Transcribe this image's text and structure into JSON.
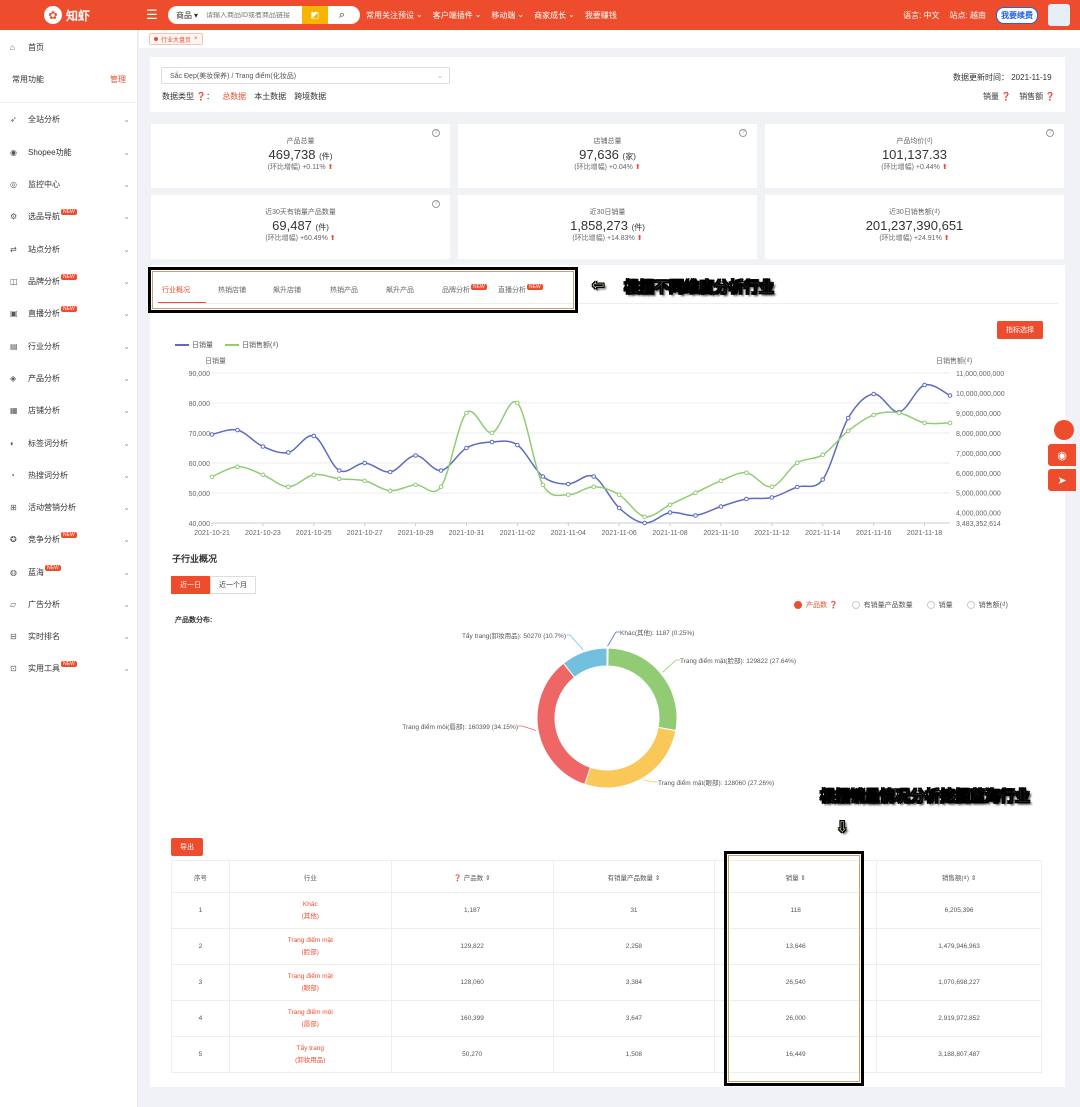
{
  "topbar": {
    "logo_text": "知虾",
    "search_type": "商品",
    "search_placeholder": "请输入商品ID或者商品链接",
    "nav": [
      "常用关注预设",
      "客户端插件",
      "移动端",
      "商家成长",
      "我要赚钱"
    ],
    "language": "语言: 中文",
    "site": "站点: 越南",
    "recharge": "我要续费"
  },
  "sidebar": {
    "items": [
      {
        "label": "首页",
        "icon": "home-icon",
        "glyph": "⌂",
        "chev": false
      },
      {
        "label": "常用功能",
        "icon": "",
        "glyph": "",
        "chev": false,
        "manage": "管理"
      },
      {
        "label": "全站分析",
        "icon": "send-icon",
        "glyph": "➶",
        "chev": true
      },
      {
        "label": "Shopee功能",
        "icon": "shopee-icon",
        "glyph": "◉",
        "chev": true
      },
      {
        "label": "监控中心",
        "icon": "location-icon",
        "glyph": "◎",
        "chev": true
      },
      {
        "label": "选品导航",
        "icon": "select-icon",
        "glyph": "⚙",
        "chev": true,
        "new": "NEW"
      },
      {
        "label": "站点分析",
        "icon": "site-icon",
        "glyph": "⇄",
        "chev": true
      },
      {
        "label": "品牌分析",
        "icon": "brand-icon",
        "glyph": "◫",
        "chev": true,
        "new": "NEW"
      },
      {
        "label": "直播分析",
        "icon": "live-icon",
        "glyph": "▣",
        "chev": true,
        "new": "NEW"
      },
      {
        "label": "行业分析",
        "icon": "industry-icon",
        "glyph": "▤",
        "chev": true
      },
      {
        "label": "产品分析",
        "icon": "product-icon",
        "glyph": "◈",
        "chev": true
      },
      {
        "label": "店铺分析",
        "icon": "shop-icon",
        "glyph": "▦",
        "chev": true
      },
      {
        "label": "标签词分析",
        "icon": "tag-icon",
        "glyph": "◐",
        "chev": true
      },
      {
        "label": "热搜词分析",
        "icon": "hot-icon",
        "glyph": "◔",
        "chev": true
      },
      {
        "label": "活动营销分析",
        "icon": "gift-icon",
        "glyph": "⊞",
        "chev": true
      },
      {
        "label": "竞争分析",
        "icon": "compete-icon",
        "glyph": "✪",
        "chev": true,
        "new": "NEW"
      },
      {
        "label": "蓝海",
        "icon": "ocean-icon",
        "glyph": "◍",
        "chev": true,
        "new": "NEW"
      },
      {
        "label": "广告分析",
        "icon": "ad-icon",
        "glyph": "▱",
        "chev": true
      },
      {
        "label": "实时排名",
        "icon": "rank-icon",
        "glyph": "⊟",
        "chev": true
      },
      {
        "label": "实用工具",
        "icon": "tool-icon",
        "glyph": "⊡",
        "chev": true,
        "new": "NEW"
      }
    ]
  },
  "tagbar": {
    "tag": "行业大盘页"
  },
  "filter": {
    "category": "Sắc Đẹp(美妆保养) / Trang điểm(化妆品)",
    "data_type_label": "数据类型 ❓：",
    "data_types": [
      "总数据",
      "本土数据",
      "跨境数据"
    ],
    "updated": "数据更新时间：  2021-11-19",
    "metric_a": "销量 ❓",
    "metric_b": "销售额 ❓"
  },
  "stats": [
    {
      "title": "产品总量",
      "value": "469,738",
      "unit": "(件)",
      "change_label": "(环比增幅)",
      "change": "+0.11%"
    },
    {
      "title": "店铺总量",
      "value": "97,636",
      "unit": "(家)",
      "change_label": "(环比增幅)",
      "change": "+0.04%"
    },
    {
      "title": "产品均价(₫)",
      "value": "101,137.33",
      "unit": "",
      "change_label": "(环比增幅)",
      "change": "+0.44%"
    },
    {
      "title": "近30天有销量产品数量",
      "value": "69,487",
      "unit": "(件)",
      "change_label": "(环比增幅)",
      "change": "+60.49%"
    },
    {
      "title": "近30日销量",
      "value": "1,858,273",
      "unit": "(件)",
      "change_label": "(环比增幅)",
      "change": "+14.83%"
    },
    {
      "title": "近30日销售额(₫)",
      "value": "201,237,390,651",
      "unit": "",
      "change_label": "(环比增幅)",
      "change": "+24.91%"
    }
  ],
  "tabs": [
    "行业概况",
    "热销店铺",
    "飙升店铺",
    "热销产品",
    "飙升产品",
    "品牌分析",
    "直播分析"
  ],
  "tab_new": "NEW",
  "annotations": {
    "a1": "根据不同维度分析行业",
    "arrow1": "⇦",
    "a2": "根据销量情况分析挖掘蓝海行业",
    "arrow2": "⇩"
  },
  "chart_button": "指标选择",
  "chart_data": {
    "type": "line",
    "x": [
      "2021-10-21",
      "2021-10-22",
      "2021-10-23",
      "2021-10-24",
      "2021-10-25",
      "2021-10-26",
      "2021-10-27",
      "2021-10-28",
      "2021-10-29",
      "2021-10-30",
      "2021-10-31",
      "2021-11-01",
      "2021-11-02",
      "2021-11-03",
      "2021-11-04",
      "2021-11-05",
      "2021-11-06",
      "2021-11-07",
      "2021-11-08",
      "2021-11-09",
      "2021-11-10",
      "2021-11-11",
      "2021-11-12",
      "2021-11-13",
      "2021-11-14",
      "2021-11-15",
      "2021-11-16",
      "2021-11-17",
      "2021-11-18",
      "2021-11-19"
    ],
    "x_ticks": [
      "2021-10-21",
      "2021-10-23",
      "2021-10-25",
      "2021-10-27",
      "2021-10-29",
      "2021-10-31",
      "2021-11-02",
      "2021-11-04",
      "2021-11-06",
      "2021-11-08",
      "2021-11-10",
      "2021-11-12",
      "2021-11-14",
      "2021-11-16",
      "2021-11-18"
    ],
    "series": [
      {
        "name": "日销量",
        "axis": "left",
        "color": "#5b6bc0",
        "values": [
          69500,
          71000,
          65500,
          63500,
          69000,
          57500,
          60000,
          57000,
          62500,
          57500,
          65000,
          67000,
          66000,
          55500,
          53000,
          55500,
          45000,
          40000,
          43500,
          42500,
          45500,
          48000,
          48500,
          52000,
          54500,
          75000,
          83000,
          77000,
          86000,
          82500
        ]
      },
      {
        "name": "日销售额(₫)",
        "axis": "right",
        "color": "#91cc75",
        "values": [
          5800000000,
          6300000000,
          5900000000,
          5300000000,
          5900000000,
          5700000000,
          5600000000,
          5100000000,
          5400000000,
          5300000000,
          9000000000,
          8000000000,
          9500000000,
          5400000000,
          4900000000,
          5300000000,
          4900000000,
          3800000000,
          4400000000,
          5000000000,
          5600000000,
          6000000000,
          5300000000,
          6500000000,
          6900000000,
          8100000000,
          8900000000,
          9000000000,
          8500000000,
          8500000000
        ]
      }
    ],
    "ylabel_left": "日销量",
    "ylabel_right": "日销售额(₫)",
    "ylim_left": [
      40000,
      90000
    ],
    "yticks_left": [
      "40,000",
      "50,000",
      "60,000",
      "70,000",
      "80,000",
      "90,000"
    ],
    "ylim_right": [
      3483352614,
      11000000000
    ],
    "yticks_right": [
      "3,483,352,614",
      "4,000,000,000",
      "5,000,000,000",
      "6,000,000,000",
      "7,000,000,000",
      "8,000,000,000",
      "9,000,000,000",
      "10,000,000,000",
      "11,000,000,000"
    ],
    "grid": true,
    "legend": "top-left"
  },
  "sub_industry": {
    "title": "子行业概况",
    "ranges": [
      "近一日",
      "近一个月"
    ],
    "radios": [
      "产品数 ❓",
      "有销量产品数量",
      "销量",
      "销售额(₫)"
    ],
    "dist_label": "产品数分布:",
    "pie": {
      "type": "pie",
      "slices": [
        {
          "label": "Khác(其他): 1187 (0.25%)",
          "value": 1187,
          "color": "#5470c6"
        },
        {
          "label": "Trang điểm mặt(脸部): 129822 (27.64%)",
          "value": 129822,
          "color": "#91cc75"
        },
        {
          "label": "Trang điểm mặt(眼部): 128060 (27.26%)",
          "value": 128060,
          "color": "#fac858"
        },
        {
          "label": "Trang điểm môi(唇部): 160399 (34.15%)",
          "value": 160399,
          "color": "#ee6666"
        },
        {
          "label": "Tẩy trang(卸妆用品): 50270 (10.7%)",
          "value": 50270,
          "color": "#73c0de"
        }
      ]
    },
    "export": "导出"
  },
  "table": {
    "headers": [
      "序号",
      "行业",
      "❓ 产品数 ⇕",
      "有销量产品数量 ⇕",
      "销量 ⇕",
      "销售额(₫) ⇕"
    ],
    "rows": [
      {
        "no": "1",
        "name": "Khác",
        "sub": "(其他)",
        "products": "1,187",
        "sold_products": "31",
        "sales": "118",
        "revenue": "6,205,396"
      },
      {
        "no": "2",
        "name": "Trang điểm mặt",
        "sub": "(脸部)",
        "products": "129,822",
        "sold_products": "2,258",
        "sales": "13,646",
        "revenue": "1,479,946,963"
      },
      {
        "no": "3",
        "name": "Trang điểm mặt",
        "sub": "(眼部)",
        "products": "128,060",
        "sold_products": "3,384",
        "sales": "26,540",
        "revenue": "1,070,698,227"
      },
      {
        "no": "4",
        "name": "Trang điểm môi",
        "sub": "(唇部)",
        "products": "160,399",
        "sold_products": "3,647",
        "sales": "26,000",
        "revenue": "2,919,972,852"
      },
      {
        "no": "5",
        "name": "Tẩy trang",
        "sub": "(卸妆用品)",
        "products": "50,270",
        "sold_products": "1,508",
        "sales": "16,449",
        "revenue": "3,188,807,487"
      }
    ]
  }
}
